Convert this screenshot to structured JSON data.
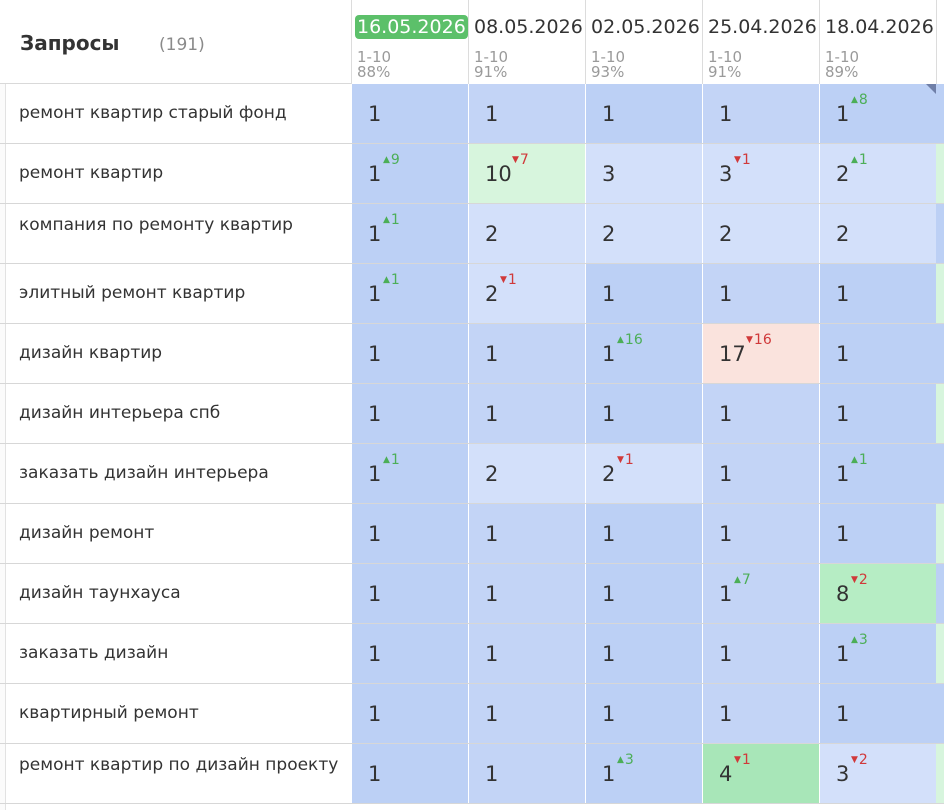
{
  "header": {
    "title": "Запросы",
    "count": "(191)"
  },
  "colors": {
    "top": "#bcd0f5",
    "top_alt": "#c3d4f6",
    "mid": "#d3e0fa",
    "good": "#d7f5dd",
    "better": "#b6edc4",
    "best": "#a8e6b8",
    "bad": "#fae3dd",
    "active_date": "#5cc06a"
  },
  "columns": [
    {
      "date": "16.05.2026",
      "range": "1-10",
      "pct": "88%",
      "active": true
    },
    {
      "date": "08.05.2026",
      "range": "1-10",
      "pct": "91%",
      "active": false
    },
    {
      "date": "02.05.2026",
      "range": "1-10",
      "pct": "93%",
      "active": false
    },
    {
      "date": "25.04.2026",
      "range": "1-10",
      "pct": "91%",
      "active": false
    },
    {
      "date": "18.04.2026",
      "range": "1-10",
      "pct": "89%",
      "active": false
    }
  ],
  "rows": [
    {
      "query": "ремонт квартир старый фонд",
      "cells": [
        {
          "pos": "1",
          "delta": "",
          "dir": "",
          "bg": "top"
        },
        {
          "pos": "1",
          "delta": "",
          "dir": "",
          "bg": "top_alt"
        },
        {
          "pos": "1",
          "delta": "",
          "dir": "",
          "bg": "top"
        },
        {
          "pos": "1",
          "delta": "",
          "dir": "",
          "bg": "top_alt"
        },
        {
          "pos": "1",
          "delta": "8",
          "dir": "up",
          "bg": "top",
          "corner": true
        }
      ]
    },
    {
      "query": "ремонт квартир",
      "cells": [
        {
          "pos": "1",
          "delta": "9",
          "dir": "up",
          "bg": "top"
        },
        {
          "pos": "10",
          "delta": "7",
          "dir": "down",
          "bg": "good"
        },
        {
          "pos": "3",
          "delta": "",
          "dir": "",
          "bg": "mid"
        },
        {
          "pos": "3",
          "delta": "1",
          "dir": "down",
          "bg": "mid"
        },
        {
          "pos": "2",
          "delta": "1",
          "dir": "up",
          "bg": "mid"
        }
      ]
    },
    {
      "query": "компания по ремонту квартир",
      "cells": [
        {
          "pos": "1",
          "delta": "1",
          "dir": "up",
          "bg": "top"
        },
        {
          "pos": "2",
          "delta": "",
          "dir": "",
          "bg": "mid"
        },
        {
          "pos": "2",
          "delta": "",
          "dir": "",
          "bg": "mid"
        },
        {
          "pos": "2",
          "delta": "",
          "dir": "",
          "bg": "mid"
        },
        {
          "pos": "2",
          "delta": "",
          "dir": "",
          "bg": "mid"
        }
      ]
    },
    {
      "query": "элитный ремонт квартир",
      "cells": [
        {
          "pos": "1",
          "delta": "1",
          "dir": "up",
          "bg": "top"
        },
        {
          "pos": "2",
          "delta": "1",
          "dir": "down",
          "bg": "mid"
        },
        {
          "pos": "1",
          "delta": "",
          "dir": "",
          "bg": "top"
        },
        {
          "pos": "1",
          "delta": "",
          "dir": "",
          "bg": "top_alt"
        },
        {
          "pos": "1",
          "delta": "",
          "dir": "",
          "bg": "top"
        }
      ]
    },
    {
      "query": "дизайн квартир",
      "cells": [
        {
          "pos": "1",
          "delta": "",
          "dir": "",
          "bg": "top"
        },
        {
          "pos": "1",
          "delta": "",
          "dir": "",
          "bg": "top_alt"
        },
        {
          "pos": "1",
          "delta": "16",
          "dir": "up",
          "bg": "top"
        },
        {
          "pos": "17",
          "delta": "16",
          "dir": "down",
          "bg": "bad"
        },
        {
          "pos": "1",
          "delta": "",
          "dir": "",
          "bg": "top"
        }
      ]
    },
    {
      "query": "дизайн интерьера спб",
      "cells": [
        {
          "pos": "1",
          "delta": "",
          "dir": "",
          "bg": "top"
        },
        {
          "pos": "1",
          "delta": "",
          "dir": "",
          "bg": "top_alt"
        },
        {
          "pos": "1",
          "delta": "",
          "dir": "",
          "bg": "top"
        },
        {
          "pos": "1",
          "delta": "",
          "dir": "",
          "bg": "top_alt"
        },
        {
          "pos": "1",
          "delta": "",
          "dir": "",
          "bg": "top"
        }
      ]
    },
    {
      "query": "заказать дизайн интерьера",
      "cells": [
        {
          "pos": "1",
          "delta": "1",
          "dir": "up",
          "bg": "top"
        },
        {
          "pos": "2",
          "delta": "",
          "dir": "",
          "bg": "mid"
        },
        {
          "pos": "2",
          "delta": "1",
          "dir": "down",
          "bg": "mid"
        },
        {
          "pos": "1",
          "delta": "",
          "dir": "",
          "bg": "top_alt"
        },
        {
          "pos": "1",
          "delta": "1",
          "dir": "up",
          "bg": "top"
        }
      ]
    },
    {
      "query": "дизайн ремонт",
      "cells": [
        {
          "pos": "1",
          "delta": "",
          "dir": "",
          "bg": "top"
        },
        {
          "pos": "1",
          "delta": "",
          "dir": "",
          "bg": "top_alt"
        },
        {
          "pos": "1",
          "delta": "",
          "dir": "",
          "bg": "top"
        },
        {
          "pos": "1",
          "delta": "",
          "dir": "",
          "bg": "top_alt"
        },
        {
          "pos": "1",
          "delta": "",
          "dir": "",
          "bg": "top"
        }
      ]
    },
    {
      "query": "дизайн таунхауса",
      "cells": [
        {
          "pos": "1",
          "delta": "",
          "dir": "",
          "bg": "top"
        },
        {
          "pos": "1",
          "delta": "",
          "dir": "",
          "bg": "top_alt"
        },
        {
          "pos": "1",
          "delta": "",
          "dir": "",
          "bg": "top"
        },
        {
          "pos": "1",
          "delta": "7",
          "dir": "up",
          "bg": "top_alt"
        },
        {
          "pos": "8",
          "delta": "2",
          "dir": "down",
          "bg": "better"
        }
      ]
    },
    {
      "query": "заказать дизайн",
      "cells": [
        {
          "pos": "1",
          "delta": "",
          "dir": "",
          "bg": "top"
        },
        {
          "pos": "1",
          "delta": "",
          "dir": "",
          "bg": "top_alt"
        },
        {
          "pos": "1",
          "delta": "",
          "dir": "",
          "bg": "top"
        },
        {
          "pos": "1",
          "delta": "",
          "dir": "",
          "bg": "top_alt"
        },
        {
          "pos": "1",
          "delta": "3",
          "dir": "up",
          "bg": "top"
        }
      ]
    },
    {
      "query": "квартирный ремонт",
      "cells": [
        {
          "pos": "1",
          "delta": "",
          "dir": "",
          "bg": "top"
        },
        {
          "pos": "1",
          "delta": "",
          "dir": "",
          "bg": "top_alt"
        },
        {
          "pos": "1",
          "delta": "",
          "dir": "",
          "bg": "top"
        },
        {
          "pos": "1",
          "delta": "",
          "dir": "",
          "bg": "top_alt"
        },
        {
          "pos": "1",
          "delta": "",
          "dir": "",
          "bg": "top"
        }
      ]
    },
    {
      "query": "ремонт квартир по дизайн проекту",
      "cells": [
        {
          "pos": "1",
          "delta": "",
          "dir": "",
          "bg": "top"
        },
        {
          "pos": "1",
          "delta": "",
          "dir": "",
          "bg": "top_alt"
        },
        {
          "pos": "1",
          "delta": "3",
          "dir": "up",
          "bg": "top"
        },
        {
          "pos": "4",
          "delta": "1",
          "dir": "down",
          "bg": "best"
        },
        {
          "pos": "3",
          "delta": "2",
          "dir": "down",
          "bg": "mid"
        }
      ]
    }
  ]
}
